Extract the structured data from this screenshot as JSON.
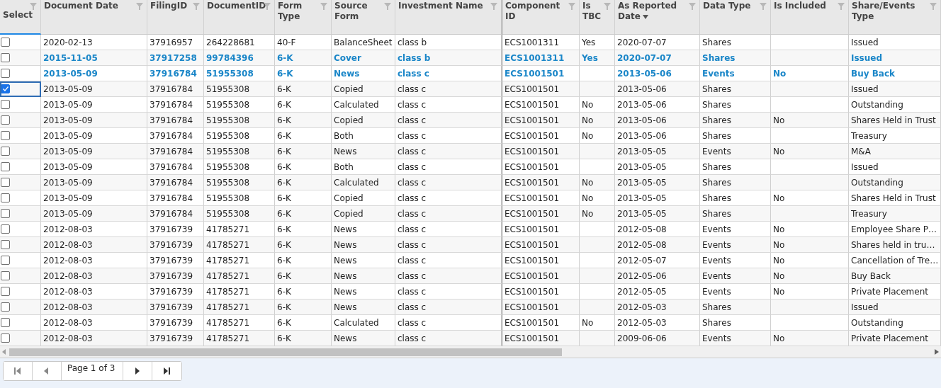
{
  "columns": [
    {
      "label": "Select",
      "sorted": false
    },
    {
      "label": "Document Date",
      "sorted": false
    },
    {
      "label": "FilingID",
      "sorted": false
    },
    {
      "label": "DocumentID",
      "sorted": false
    },
    {
      "label": "Form Type",
      "sorted": false
    },
    {
      "label": "Source Form",
      "sorted": false
    },
    {
      "label": "Investment Name",
      "sorted": false
    },
    {
      "label": "Component ID",
      "sorted": false
    },
    {
      "label": "Is TBC",
      "sorted": false
    },
    {
      "label": "As Reported Date",
      "sorted": true
    },
    {
      "label": "Data Type",
      "sorted": false
    },
    {
      "label": "Is Included",
      "sorted": false
    },
    {
      "label": "Share/Events Type",
      "sorted": false
    }
  ],
  "rows": [
    {
      "checked": false,
      "bold": false,
      "cells": [
        "2020-02-13",
        "37916957",
        "264228681",
        "40-F",
        "BalanceSheet",
        "class b",
        "ECS1001311",
        "Yes",
        "2020-07-07",
        "Shares",
        null,
        "Issued"
      ]
    },
    {
      "checked": false,
      "bold": true,
      "cells": [
        "2015-11-05",
        "37917258",
        "99784396",
        "6-K",
        "Cover",
        "class b",
        "ECS1001311",
        "Yes",
        "2020-07-07",
        "Shares",
        null,
        "Issued"
      ]
    },
    {
      "checked": false,
      "bold": true,
      "cells": [
        "2013-05-09",
        "37916784",
        "51955308",
        "6-K",
        "News",
        "class c",
        "ECS1001501",
        null,
        "2013-05-06",
        "Events",
        "No",
        "Buy Back"
      ]
    },
    {
      "checked": true,
      "bold": false,
      "cells": [
        "2013-05-09",
        "37916784",
        "51955308",
        "6-K",
        "Copied",
        "class c",
        "ECS1001501",
        null,
        "2013-05-06",
        "Shares",
        null,
        "Issued"
      ]
    },
    {
      "checked": false,
      "bold": false,
      "cells": [
        "2013-05-09",
        "37916784",
        "51955308",
        "6-K",
        "Calculated",
        "class c",
        "ECS1001501",
        "No",
        "2013-05-06",
        "Shares",
        null,
        "Outstanding"
      ]
    },
    {
      "checked": false,
      "bold": false,
      "cells": [
        "2013-05-09",
        "37916784",
        "51955308",
        "6-K",
        "Copied",
        "class c",
        "ECS1001501",
        "No",
        "2013-05-06",
        "Shares",
        "No",
        "Shares Held in Trust"
      ]
    },
    {
      "checked": false,
      "bold": false,
      "cells": [
        "2013-05-09",
        "37916784",
        "51955308",
        "6-K",
        "Both",
        "class c",
        "ECS1001501",
        "No",
        "2013-05-06",
        "Shares",
        null,
        "Treasury"
      ]
    },
    {
      "checked": false,
      "bold": false,
      "cells": [
        "2013-05-09",
        "37916784",
        "51955308",
        "6-K",
        "News",
        "class c",
        "ECS1001501",
        null,
        "2013-05-05",
        "Events",
        "No",
        "M&A"
      ]
    },
    {
      "checked": false,
      "bold": false,
      "cells": [
        "2013-05-09",
        "37916784",
        "51955308",
        "6-K",
        "Both",
        "class c",
        "ECS1001501",
        null,
        "2013-05-05",
        "Shares",
        null,
        "Issued"
      ]
    },
    {
      "checked": false,
      "bold": false,
      "cells": [
        "2013-05-09",
        "37916784",
        "51955308",
        "6-K",
        "Calculated",
        "class c",
        "ECS1001501",
        "No",
        "2013-05-05",
        "Shares",
        null,
        "Outstanding"
      ]
    },
    {
      "checked": false,
      "bold": false,
      "cells": [
        "2013-05-09",
        "37916784",
        "51955308",
        "6-K",
        "Copied",
        "class c",
        "ECS1001501",
        "No",
        "2013-05-05",
        "Shares",
        "No",
        "Shares Held in Trust"
      ]
    },
    {
      "checked": false,
      "bold": false,
      "cells": [
        "2013-05-09",
        "37916784",
        "51955308",
        "6-K",
        "Copied",
        "class c",
        "ECS1001501",
        "No",
        "2013-05-05",
        "Shares",
        null,
        "Treasury"
      ]
    },
    {
      "checked": false,
      "bold": false,
      "cells": [
        "2012-08-03",
        "37916739",
        "41785271",
        "6-K",
        "News",
        "class c",
        "ECS1001501",
        null,
        "2012-05-08",
        "Events",
        "No",
        "Employee Share P…"
      ]
    },
    {
      "checked": false,
      "bold": false,
      "cells": [
        "2012-08-03",
        "37916739",
        "41785271",
        "6-K",
        "News",
        "class c",
        "ECS1001501",
        null,
        "2012-05-08",
        "Events",
        "No",
        "Shares held in tru…"
      ]
    },
    {
      "checked": false,
      "bold": false,
      "cells": [
        "2012-08-03",
        "37916739",
        "41785271",
        "6-K",
        "News",
        "class c",
        "ECS1001501",
        null,
        "2012-05-07",
        "Events",
        "No",
        "Cancellation of Tre…"
      ]
    },
    {
      "checked": false,
      "bold": false,
      "cells": [
        "2012-08-03",
        "37916739",
        "41785271",
        "6-K",
        "News",
        "class c",
        "ECS1001501",
        null,
        "2012-05-06",
        "Events",
        "No",
        "Buy Back"
      ]
    },
    {
      "checked": false,
      "bold": false,
      "cells": [
        "2012-08-03",
        "37916739",
        "41785271",
        "6-K",
        "News",
        "class c",
        "ECS1001501",
        null,
        "2012-05-05",
        "Events",
        "No",
        "Private Placement"
      ]
    },
    {
      "checked": false,
      "bold": false,
      "cells": [
        "2012-08-03",
        "37916739",
        "41785271",
        "6-K",
        "News",
        "class c",
        "ECS1001501",
        null,
        "2012-05-03",
        "Shares",
        null,
        "Issued"
      ]
    },
    {
      "checked": false,
      "bold": false,
      "cells": [
        "2012-08-03",
        "37916739",
        "41785271",
        "6-K",
        "Calculated",
        "class c",
        "ECS1001501",
        "No",
        "2012-05-03",
        "Shares",
        null,
        "Outstanding"
      ]
    },
    {
      "checked": false,
      "bold": false,
      "cells": [
        "2012-08-03",
        "37916739",
        "41785271",
        "6-K",
        "News",
        "class c",
        "ECS1001501",
        null,
        "2009-06-06",
        "Events",
        "No",
        "Private Placement"
      ]
    }
  ],
  "pager": {
    "label": "Page 1 of 3"
  }
}
